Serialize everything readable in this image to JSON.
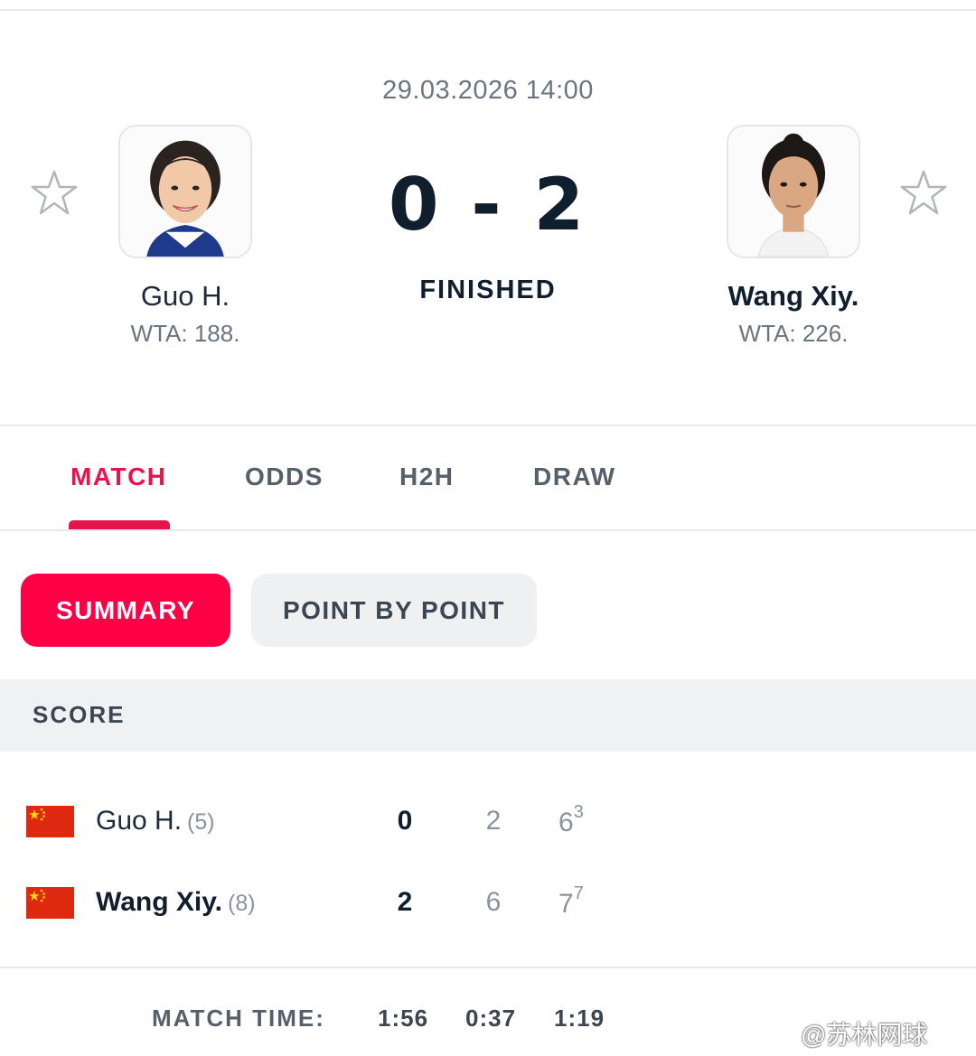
{
  "match": {
    "datetime": "29.03.2026 14:00",
    "score": "0 - 2",
    "status": "FINISHED"
  },
  "home": {
    "name": "Guo H.",
    "rank": "WTA: 188.",
    "seed": "(5)",
    "sets": "0",
    "set1": "2",
    "set2": "6",
    "set2_tiebreak": "3"
  },
  "away": {
    "name": "Wang Xiy.",
    "rank": "WTA: 226.",
    "seed": "(8)",
    "sets": "2",
    "set1": "6",
    "set2": "7",
    "set2_tiebreak": "7"
  },
  "tabs": [
    {
      "label": "MATCH",
      "active": true
    },
    {
      "label": "ODDS"
    },
    {
      "label": "H2H"
    },
    {
      "label": "DRAW"
    }
  ],
  "subtabs": {
    "summary": "SUMMARY",
    "point_by_point": "POINT BY POINT"
  },
  "score_section": {
    "title": "SCORE"
  },
  "match_time": {
    "label": "MATCH TIME:",
    "total": "1:56",
    "set1": "0:37",
    "set2": "1:19"
  },
  "watermark": "@苏林网球",
  "colors": {
    "accent": "#ff0046",
    "active_tab": "#e4154b",
    "flag_red": "#de2910",
    "flag_star": "#ffde00"
  },
  "icons": [
    "star-icon",
    "player-photo",
    "china-flag-icon"
  ]
}
